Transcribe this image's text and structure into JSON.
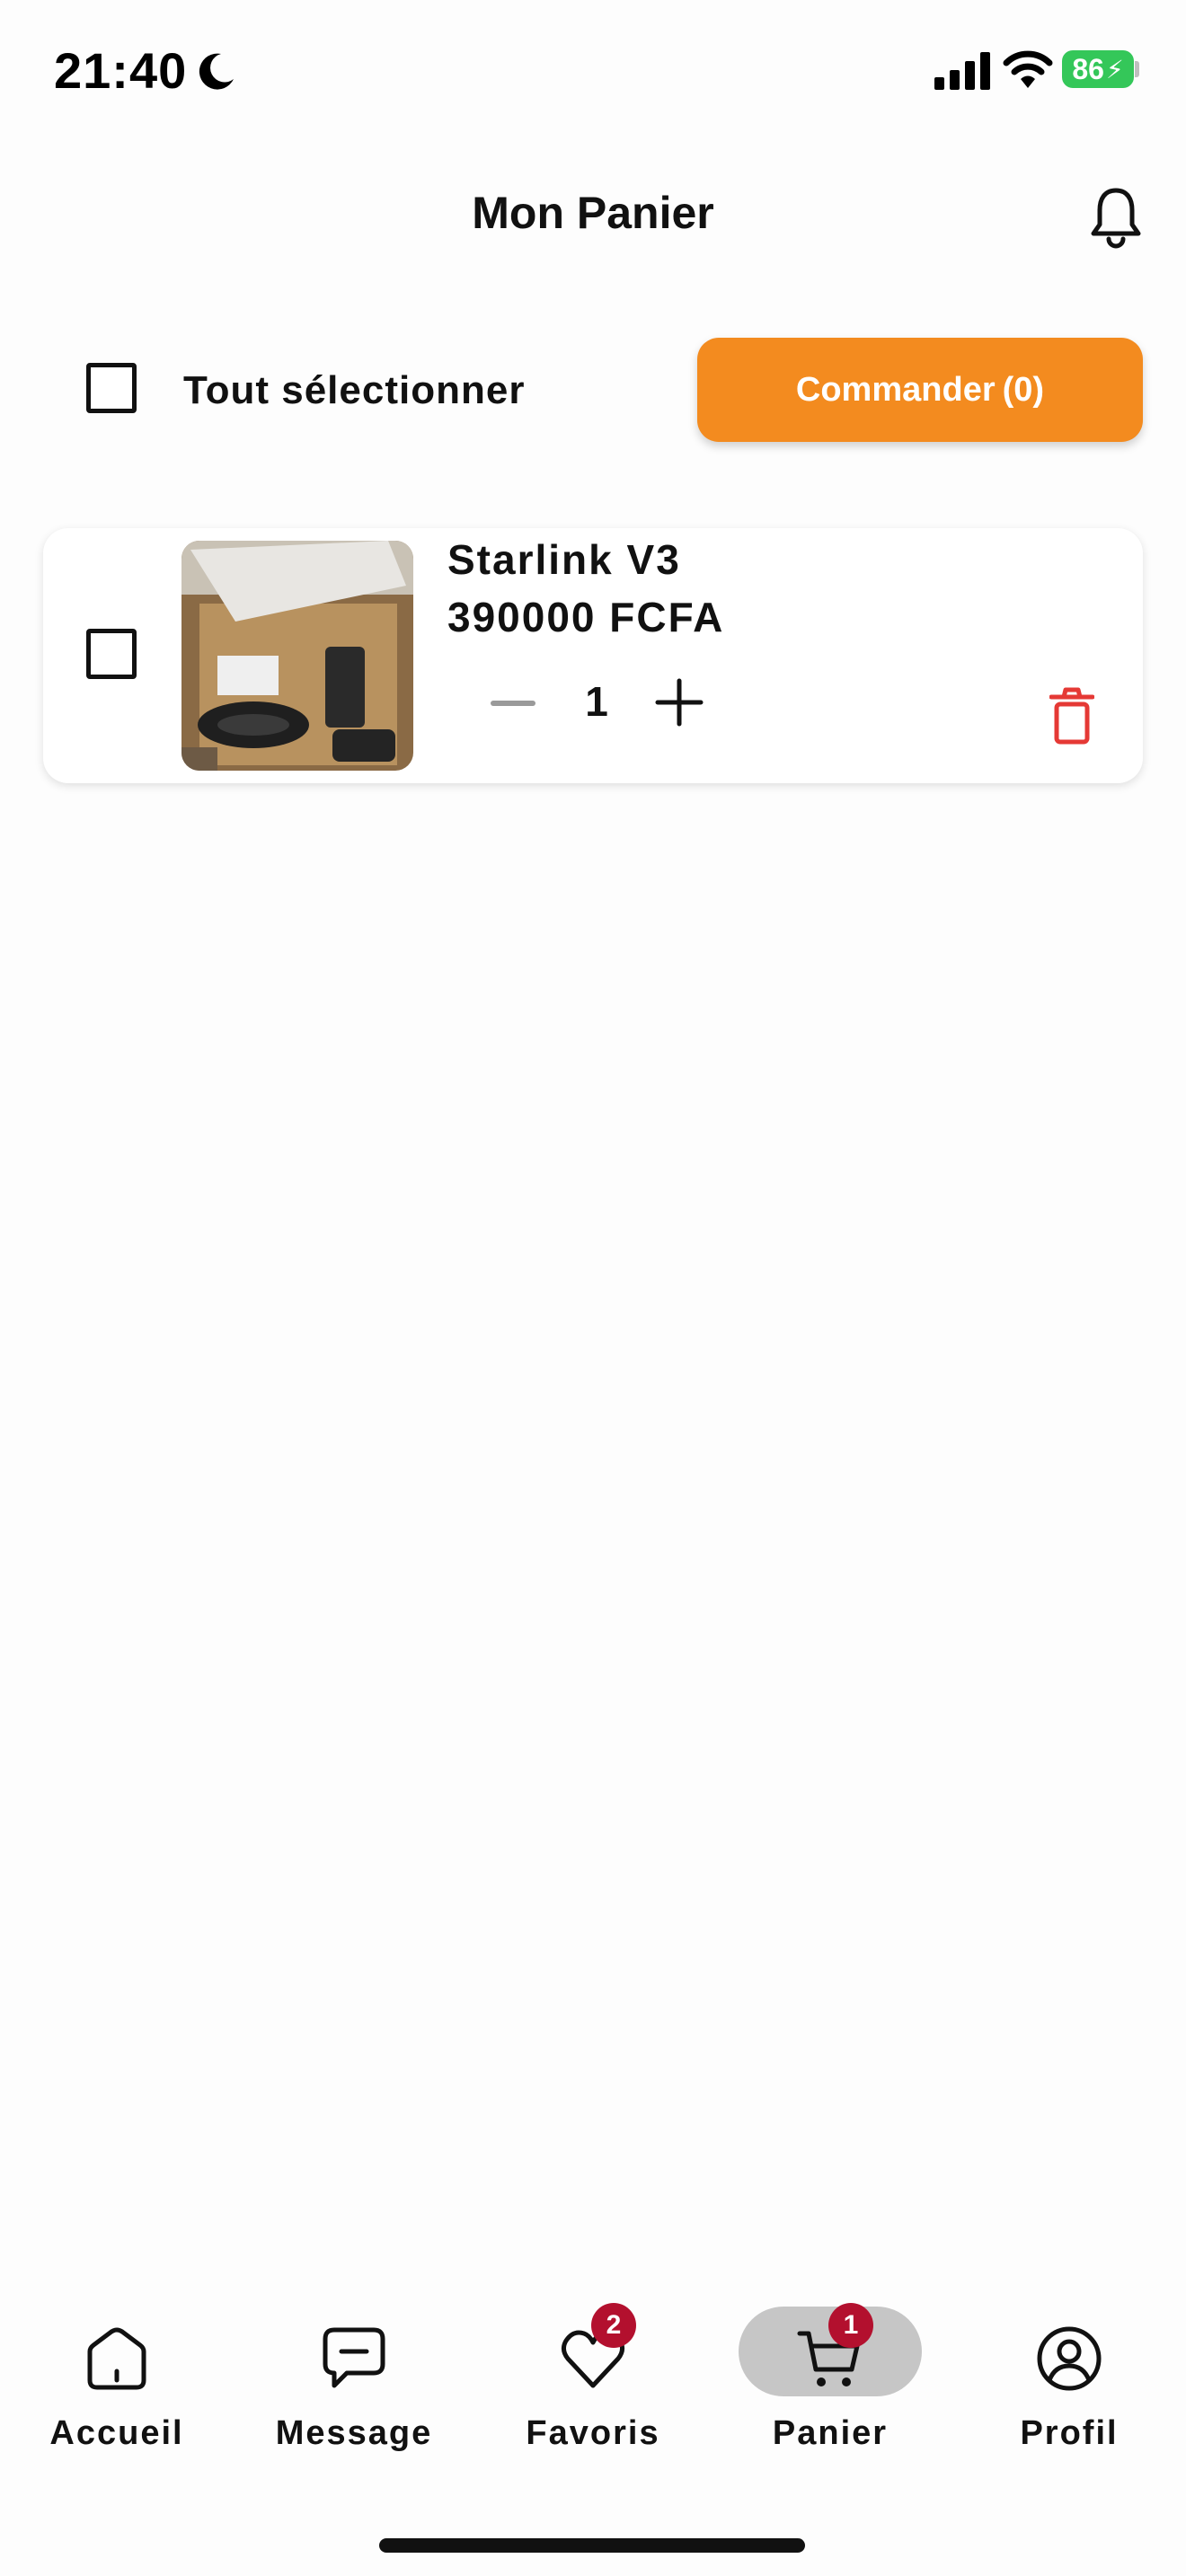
{
  "status_bar": {
    "time": "21:40",
    "battery": "86",
    "icons": [
      "moon-icon",
      "signal-icon",
      "wifi-icon",
      "battery-icon"
    ]
  },
  "header": {
    "title": "Mon Panier",
    "icon": "bell-icon"
  },
  "toolbar": {
    "select_all_label": "Tout sélectionner",
    "order_label": "Commander",
    "order_count": "(0)"
  },
  "cart": {
    "items": [
      {
        "name": "Starlink V3",
        "price": "390000 FCFA",
        "quantity": "1"
      }
    ]
  },
  "bottom_nav": {
    "items": [
      {
        "label": "Accueil",
        "icon": "home-icon"
      },
      {
        "label": "Message",
        "icon": "message-icon"
      },
      {
        "label": "Favoris",
        "icon": "heart-icon",
        "badge": "2"
      },
      {
        "label": "Panier",
        "icon": "cart-icon",
        "badge": "1",
        "active": true
      },
      {
        "label": "Profil",
        "icon": "profile-icon"
      }
    ]
  },
  "colors": {
    "accent": "#f38b1f",
    "badge": "#b3102e",
    "delete": "#e53935",
    "battery": "#34c759",
    "active_tab": "#c6c6c6"
  }
}
